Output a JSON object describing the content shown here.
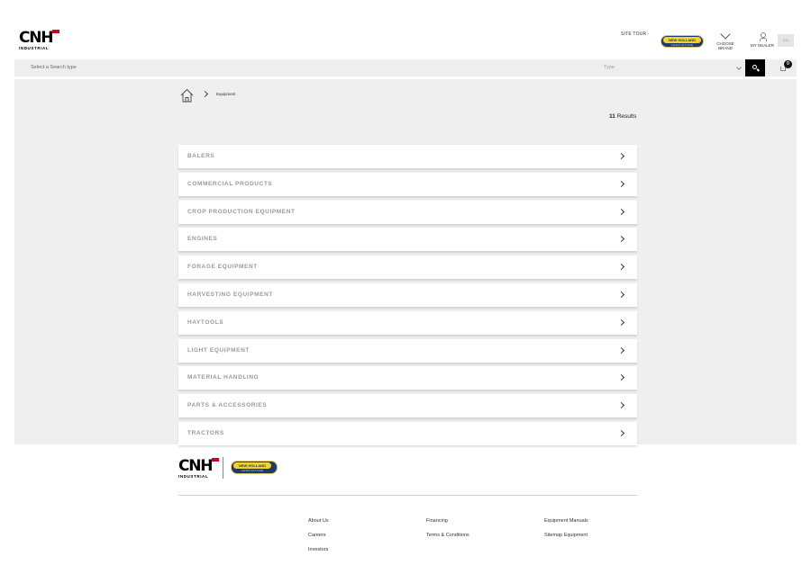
{
  "header": {
    "logo_text": "CNH",
    "logo_sub": "INDUSTRIAL",
    "site_tour": "SITE TOUR",
    "brand_badge": {
      "top": "NEW HOLLAND",
      "bottom": "AGRICULTURE"
    },
    "choose_brand": "CHOOSE BRAND",
    "my_dealer": "MY DEALER",
    "language": "EN"
  },
  "search": {
    "search_type_placeholder": "Select a Search type",
    "type_placeholder": "Type",
    "cart_count": "0"
  },
  "breadcrumb": {
    "current": "Equipment"
  },
  "results": {
    "count": "11",
    "label": "Results"
  },
  "categories": [
    "BALERS",
    "COMMERCIAL PRODUCTS",
    "CROP PRODUCTION EQUIPMENT",
    "ENGINES",
    "FORAGE EQUIPMENT",
    "HARVESTING EQUIPMENT",
    "HAYTOOLS",
    "LIGHT EQUIPMENT",
    "MATERIAL HANDLING",
    "PARTS & ACCESSORIES",
    "TRACTORS"
  ],
  "footer": {
    "col1": [
      "About Us",
      "Careers",
      "Investors"
    ],
    "col2": [
      "Financing",
      "Terms & Conditions"
    ],
    "col3": [
      "Equipment Manuals",
      "Sitemap Equipment"
    ]
  },
  "colors": {
    "cnh_red": "#d0021b",
    "nh_blue": "#1f3a6e",
    "nh_yellow": "#f2d230",
    "search_button": "#000000"
  }
}
